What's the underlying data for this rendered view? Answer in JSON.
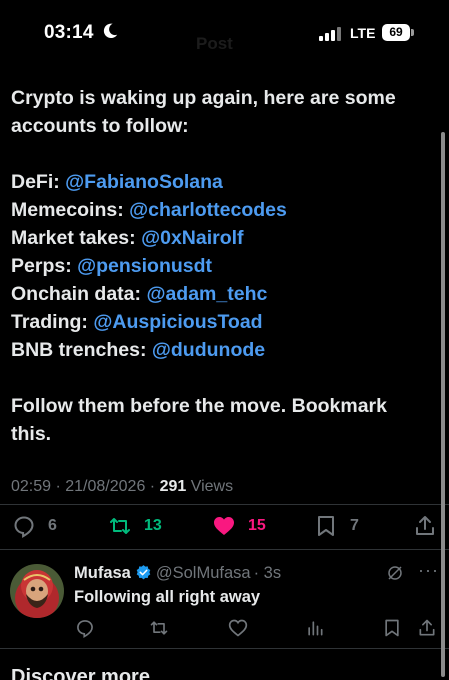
{
  "status_bar": {
    "time": "03:14",
    "network": "LTE",
    "battery": "69"
  },
  "header_ghost": "Post",
  "tweet": {
    "intro_line1": "Crypto is waking up again, here are some",
    "intro_line2": "accounts to follow:",
    "accounts": [
      {
        "label": "DeFi: ",
        "handle": "@FabianoSolana"
      },
      {
        "label": "Memecoins: ",
        "handle": "@charlottecodes"
      },
      {
        "label": "Market takes: ",
        "handle": "@0xNairolf"
      },
      {
        "label": "Perps: ",
        "handle": "@pensionusdt"
      },
      {
        "label": "Onchain data: ",
        "handle": "@adam_tehc"
      },
      {
        "label": "Trading: ",
        "handle": "@AuspiciousToad"
      },
      {
        "label": "BNB trenches: ",
        "handle": "@dudunode"
      }
    ],
    "outro_line1": "Follow them before the move. Bookmark",
    "outro_line2": "this.",
    "timestamp": "02:59 · 21/08/2026 · ",
    "views_count": "291",
    "views_label": " Views",
    "replies": "6",
    "reposts": "13",
    "likes": "15",
    "bookmarks": "7"
  },
  "colors": {
    "mention": "#4d9bf0",
    "repost": "#00ba7c",
    "like": "#f91880",
    "muted": "#71767b"
  },
  "reply": {
    "name": "Mufasa",
    "handle": "@SolMufasa",
    "time": "· 3s",
    "text": "Following all right away"
  },
  "discover": "Discover more",
  "icons": [
    "moon-icon",
    "signal-icon",
    "battery-icon",
    "reply-icon",
    "repost-icon",
    "heart-icon",
    "bookmark-icon",
    "share-icon",
    "verified-icon",
    "grok-icon",
    "more-icon",
    "analytics-icon"
  ]
}
